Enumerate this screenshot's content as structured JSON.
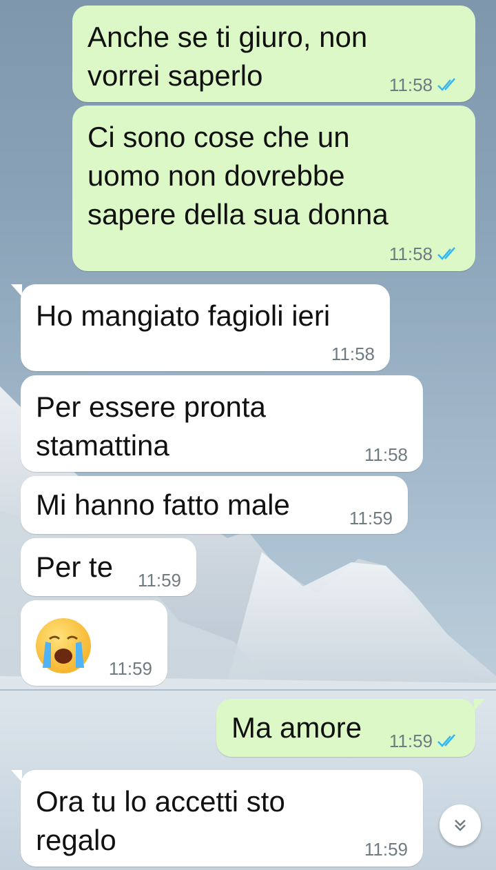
{
  "chat": {
    "messages": [
      {
        "dir": "out",
        "text": "Anche se ti giuro, non\nvorrei saperlo",
        "time": "11:58",
        "read": true
      },
      {
        "dir": "out",
        "text": "Ci sono cose che un\nuomo non dovrebbe\nsapere della sua donna",
        "time": "11:58",
        "read": true
      },
      {
        "dir": "in",
        "text": "Ho mangiato fagioli ieri",
        "time": "11:58"
      },
      {
        "dir": "in",
        "text": "Per essere pronta\nstamattina",
        "time": "11:58"
      },
      {
        "dir": "in",
        "text": "Mi hanno fatto male",
        "time": "11:59"
      },
      {
        "dir": "in",
        "text": "Per te",
        "time": "11:59"
      },
      {
        "dir": "in",
        "emoji": "loudly-crying-face",
        "time": "11:59"
      },
      {
        "dir": "out",
        "text": "Ma amore",
        "time": "11:59",
        "read": true
      },
      {
        "dir": "in",
        "text": "Ora tu lo accetti sto\nregalo",
        "time": "11:59"
      }
    ]
  },
  "colors": {
    "outgoing_bubble": "#dcf8c6",
    "incoming_bubble": "#ffffff",
    "read_ticks": "#34b7f1",
    "timestamp": "#6f7b82"
  },
  "controls": {
    "scroll_button_icon": "double-chevron-down-icon"
  }
}
